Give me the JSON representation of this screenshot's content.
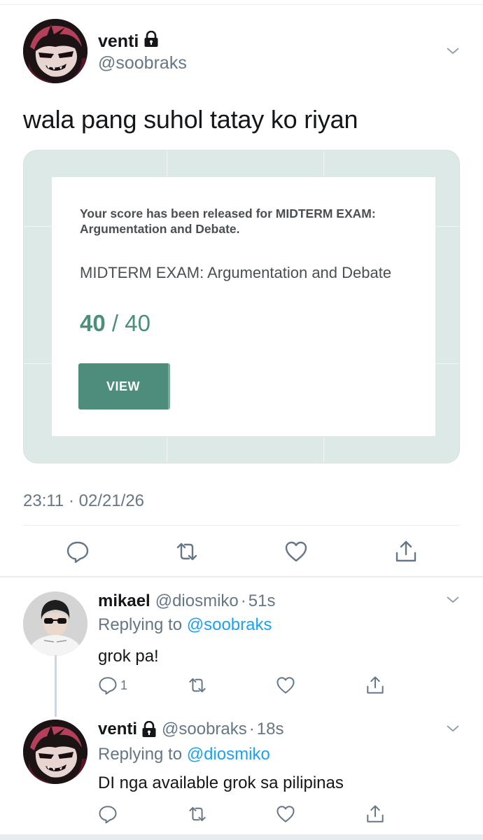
{
  "main_tweet": {
    "display_name": "venti",
    "handle": "@soobraks",
    "text": "wala pang suhol tatay ko riyan",
    "timestamp": "23:11 · 02/21/26",
    "attachment": {
      "notice": "Your score has been released for MIDTERM EXAM: Argumentation and Debate.",
      "exam_title": "MIDTERM EXAM: Argumentation and Debate",
      "score": "40",
      "score_separator": "/",
      "total": "40",
      "button_label": "VIEW",
      "accent_color": "#4e8d7b"
    },
    "actions": [
      "reply-icon",
      "retweet-icon",
      "like-icon",
      "share-icon"
    ]
  },
  "replies": [
    {
      "display_name": "mikael",
      "handle": "@diosmiko",
      "separator": "·",
      "time": "51s",
      "replying_prefix": "Replying to",
      "replying_to": "@soobraks",
      "text": "grok pa!",
      "reply_count": "1"
    },
    {
      "display_name": "venti",
      "handle": "@soobraks",
      "separator": "·",
      "time": "18s",
      "replying_prefix": "Replying to",
      "replying_to": "@diosmiko",
      "text": "DI nga available grok sa pilipinas",
      "reply_count": ""
    }
  ],
  "colors": {
    "text_primary": "#14171a",
    "text_secondary": "#657786",
    "link": "#1da1f2",
    "divider": "#e6ecf0"
  }
}
